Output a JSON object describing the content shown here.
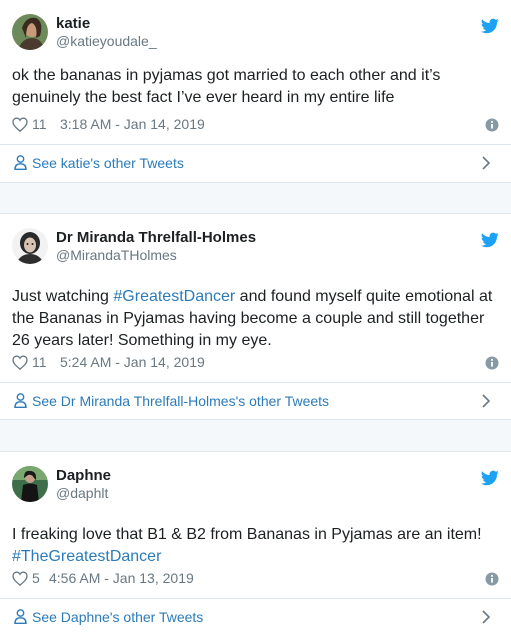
{
  "tweets": [
    {
      "name": "katie",
      "handle": "@katieyoudale_",
      "text_parts": [
        {
          "t": "ok the bananas in pyjamas got married to each other and it’s genuinely the best fact I’ve ever heard in my entire life",
          "link": false
        }
      ],
      "likes": "11",
      "time": "3:18 AM - Jan 14, 2019",
      "other_label": "See katie's other Tweets"
    },
    {
      "name": "Dr Miranda Threlfall-Holmes",
      "handle": "@MirandaTHolmes",
      "text_parts": [
        {
          "t": "Just watching ",
          "link": false
        },
        {
          "t": "#GreatestDancer",
          "link": true
        },
        {
          "t": " and found myself quite emotional at the Bananas in Pyjamas having become a couple and still together 26 years later! Something in my eye.",
          "link": false
        }
      ],
      "likes": "11",
      "time": "5:24 AM - Jan 14, 2019",
      "other_label": "See Dr Miranda Threlfall-Holmes's other Tweets"
    },
    {
      "name": "Daphne",
      "handle": "@daphlt",
      "text_parts": [
        {
          "t": "I freaking love that B1 & B2 from Bananas in Pyjamas are an item! ",
          "link": false
        },
        {
          "t": "#TheGreatestDancer",
          "link": true
        }
      ],
      "likes": "5",
      "time": "4:56 AM - Jan 13, 2019",
      "other_label": "See Daphne's other Tweets"
    }
  ],
  "icons": {
    "heart": "heart-icon",
    "info": "info-icon",
    "bird": "twitter-bird-icon",
    "user": "user-icon",
    "chevron": "chevron-right-icon"
  },
  "colors": {
    "link": "#2b7bb9",
    "twitter_blue": "#1da1f2",
    "meta_gray": "#697882",
    "border": "#e1e8ed",
    "background": "#f5f8fa"
  }
}
